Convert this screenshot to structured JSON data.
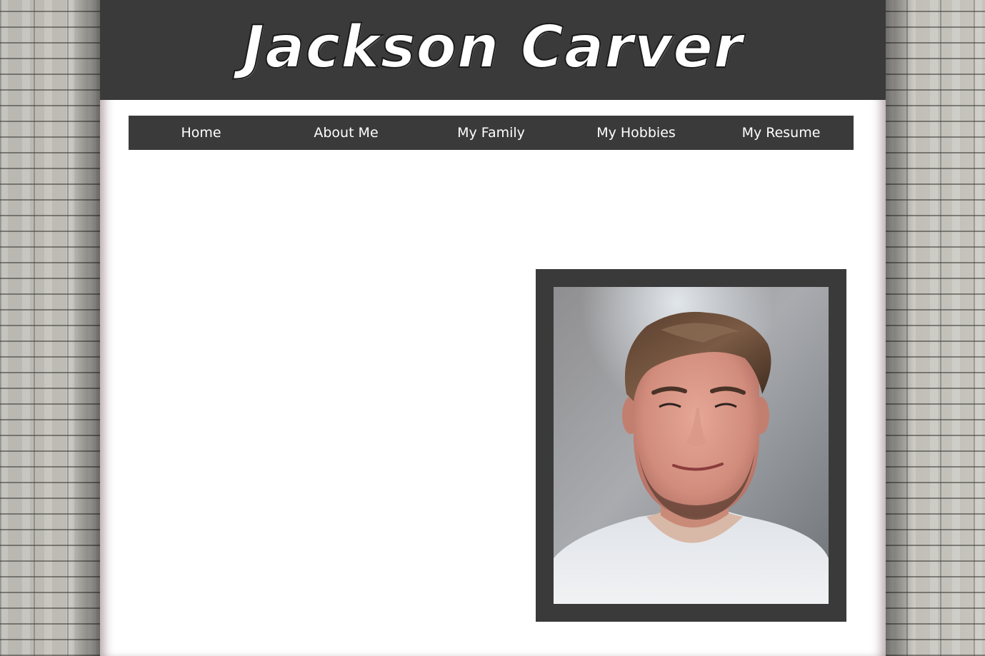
{
  "header": {
    "site_title": "Jackson Carver"
  },
  "nav": {
    "items": [
      {
        "label": "Home"
      },
      {
        "label": "About Me"
      },
      {
        "label": "My Family"
      },
      {
        "label": "My Hobbies"
      },
      {
        "label": "My Resume"
      }
    ]
  },
  "colors": {
    "header_bg": "#3a3a3a",
    "nav_bg": "#3a3a3a",
    "frame_bg": "#3a3a3a",
    "page_bg": "#ffffff",
    "text_light": "#ffffff"
  },
  "main": {
    "profile_photo": {
      "icon": "portrait-photo"
    }
  }
}
